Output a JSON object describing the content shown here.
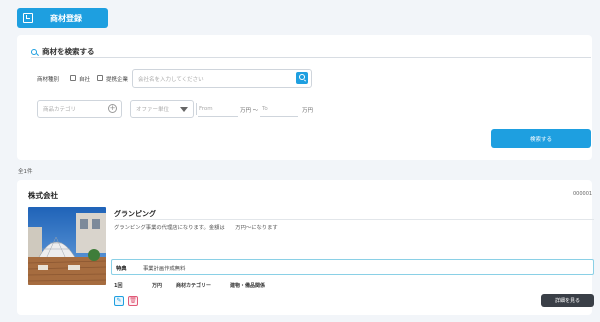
{
  "register_button": {
    "label": "商材登録",
    "icon": "folder-add-icon"
  },
  "search": {
    "title": "商材を検索する",
    "type_label": "商材種別",
    "option_company": "自社",
    "option_partner": "提携企業",
    "company_placeholder": "会社名を入力してください",
    "category_placeholder": "商品カテゴリ",
    "offer_placeholder": "オファー単位",
    "from_placeholder": "From",
    "to_placeholder": "To",
    "unit_from": "万円 ～",
    "unit_to": "万円",
    "submit_label": "検索する"
  },
  "results": {
    "count_label": "全1件",
    "items": [
      {
        "company": "株式会社",
        "id": "000001",
        "title": "グランピング",
        "description": "グランピング事業の代理店になります。金額は　　万円～になります",
        "feature_label": "特典",
        "feature_value": "事業計画作成無料",
        "unit": "1回",
        "price_unit": "万円",
        "category_label": "商材カテゴリー",
        "category_value": "建物・備品関係",
        "detail_label": "詳細を見る"
      }
    ]
  },
  "colors": {
    "accent": "#1e9fe0",
    "dark_button": "#3a3f47",
    "delete": "#e05a78"
  }
}
